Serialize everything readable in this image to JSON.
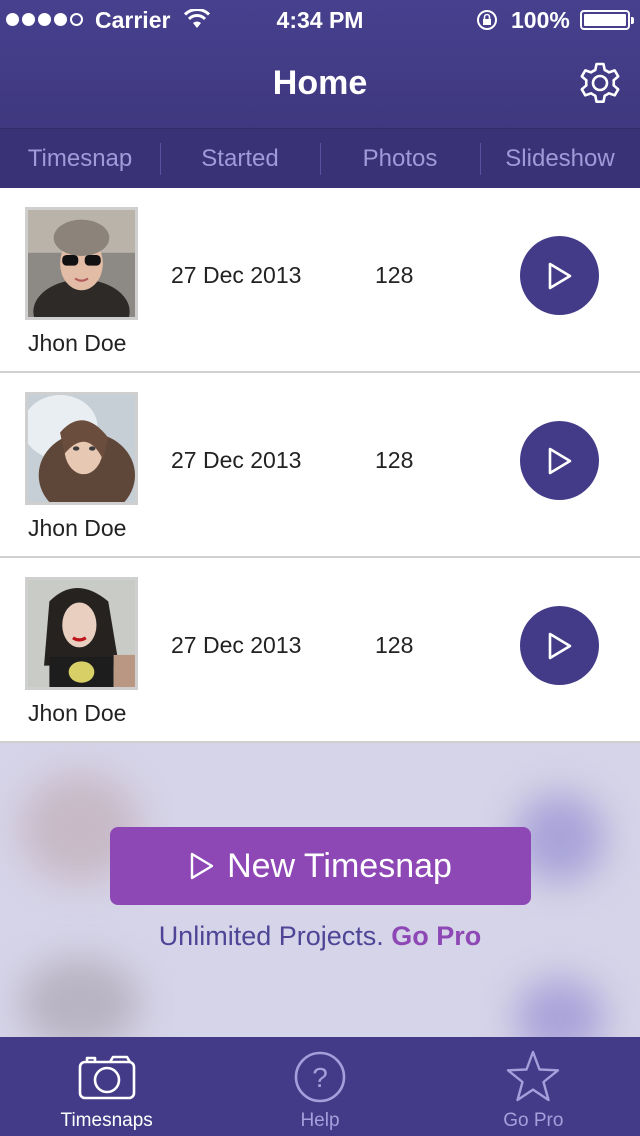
{
  "status_bar": {
    "carrier": "Carrier",
    "time": "4:34 PM",
    "battery": "100%",
    "signal_bars": 4,
    "signal_total": 5
  },
  "nav": {
    "title": "Home",
    "settings_icon": "gear-icon"
  },
  "segments": [
    {
      "label": "Timesnap"
    },
    {
      "label": "Started"
    },
    {
      "label": "Photos"
    },
    {
      "label": "Slideshow"
    }
  ],
  "rows": [
    {
      "name": "Jhon Doe",
      "date": "27 Dec 2013",
      "count": "128",
      "play_icon": "play-icon"
    },
    {
      "name": "Jhon Doe",
      "date": "27 Dec 2013",
      "count": "128",
      "play_icon": "play-icon"
    },
    {
      "name": "Jhon Doe",
      "date": "27 Dec 2013",
      "count": "128",
      "play_icon": "play-icon"
    }
  ],
  "cta": {
    "button_label": "New Timesnap",
    "promo_text": "Unlimited Projects.",
    "promo_link": "Go Pro"
  },
  "tabs": [
    {
      "label": "Timesnaps",
      "icon": "camera-icon",
      "active": true
    },
    {
      "label": "Help",
      "icon": "help-icon",
      "active": false
    },
    {
      "label": "Go Pro",
      "icon": "star-icon",
      "active": false
    }
  ],
  "colors": {
    "primary": "#433b87",
    "accent": "#8e48b6",
    "segment_text": "#a09ad8",
    "overlay": "#d6d4e8"
  }
}
